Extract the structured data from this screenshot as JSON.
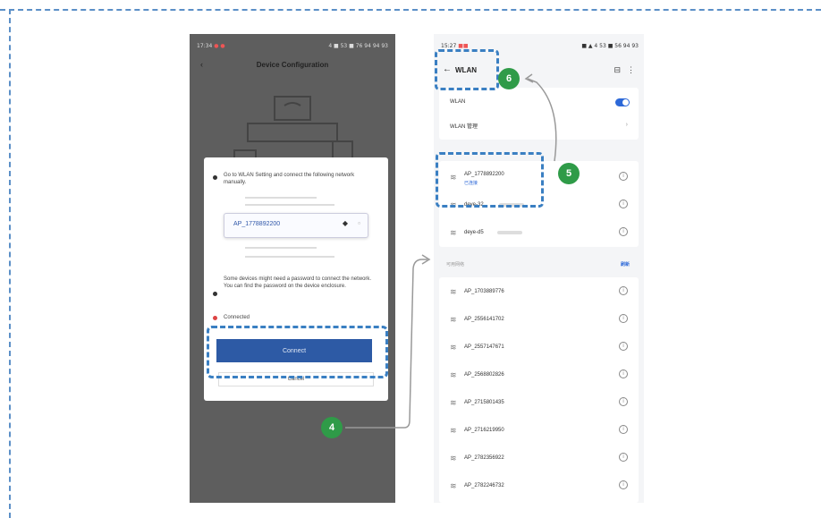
{
  "steps": {
    "four": "4",
    "five": "5",
    "six": "6"
  },
  "left_phone": {
    "status_time": "17:34",
    "status_right": "4 ■ 53 ■ 76 94 94 93",
    "back_icon": "‹",
    "title": "Device Configuration",
    "dialog": {
      "instruction": "Go to WLAN Setting and connect the following network manually.",
      "ap_name": "AP_1778892200",
      "password_note": "Some devices might need a password to connect the network. You can find the password on the device enclosure.",
      "connected": "Connected",
      "connect_button": "Connect",
      "cancel_button": "Cancel"
    }
  },
  "right_phone": {
    "status_time": "15:27",
    "status_right": "■ ▲ 4 53 ■ 56 94 93",
    "back_icon": "←",
    "title": "WLAN",
    "wlan_label": "WLAN",
    "wlan_manage": "WLAN 管理",
    "current_ap": "AP_1778892200",
    "current_ap_sub": "已连接",
    "saved_networks": [
      "deye-32",
      "deye-d5"
    ],
    "section_available": "可用网络",
    "section_refresh": "刷新",
    "available": [
      "AP_1703889776",
      "AP_2556141702",
      "AP_2557147671",
      "AP_2568802826",
      "AP_2715801435",
      "AP_2716219950",
      "AP_2782356922",
      "AP_2782246732"
    ]
  },
  "colors": {
    "accent": "#2f9b48",
    "highlight": "#3a7fc2",
    "button": "#2d5aa5"
  }
}
